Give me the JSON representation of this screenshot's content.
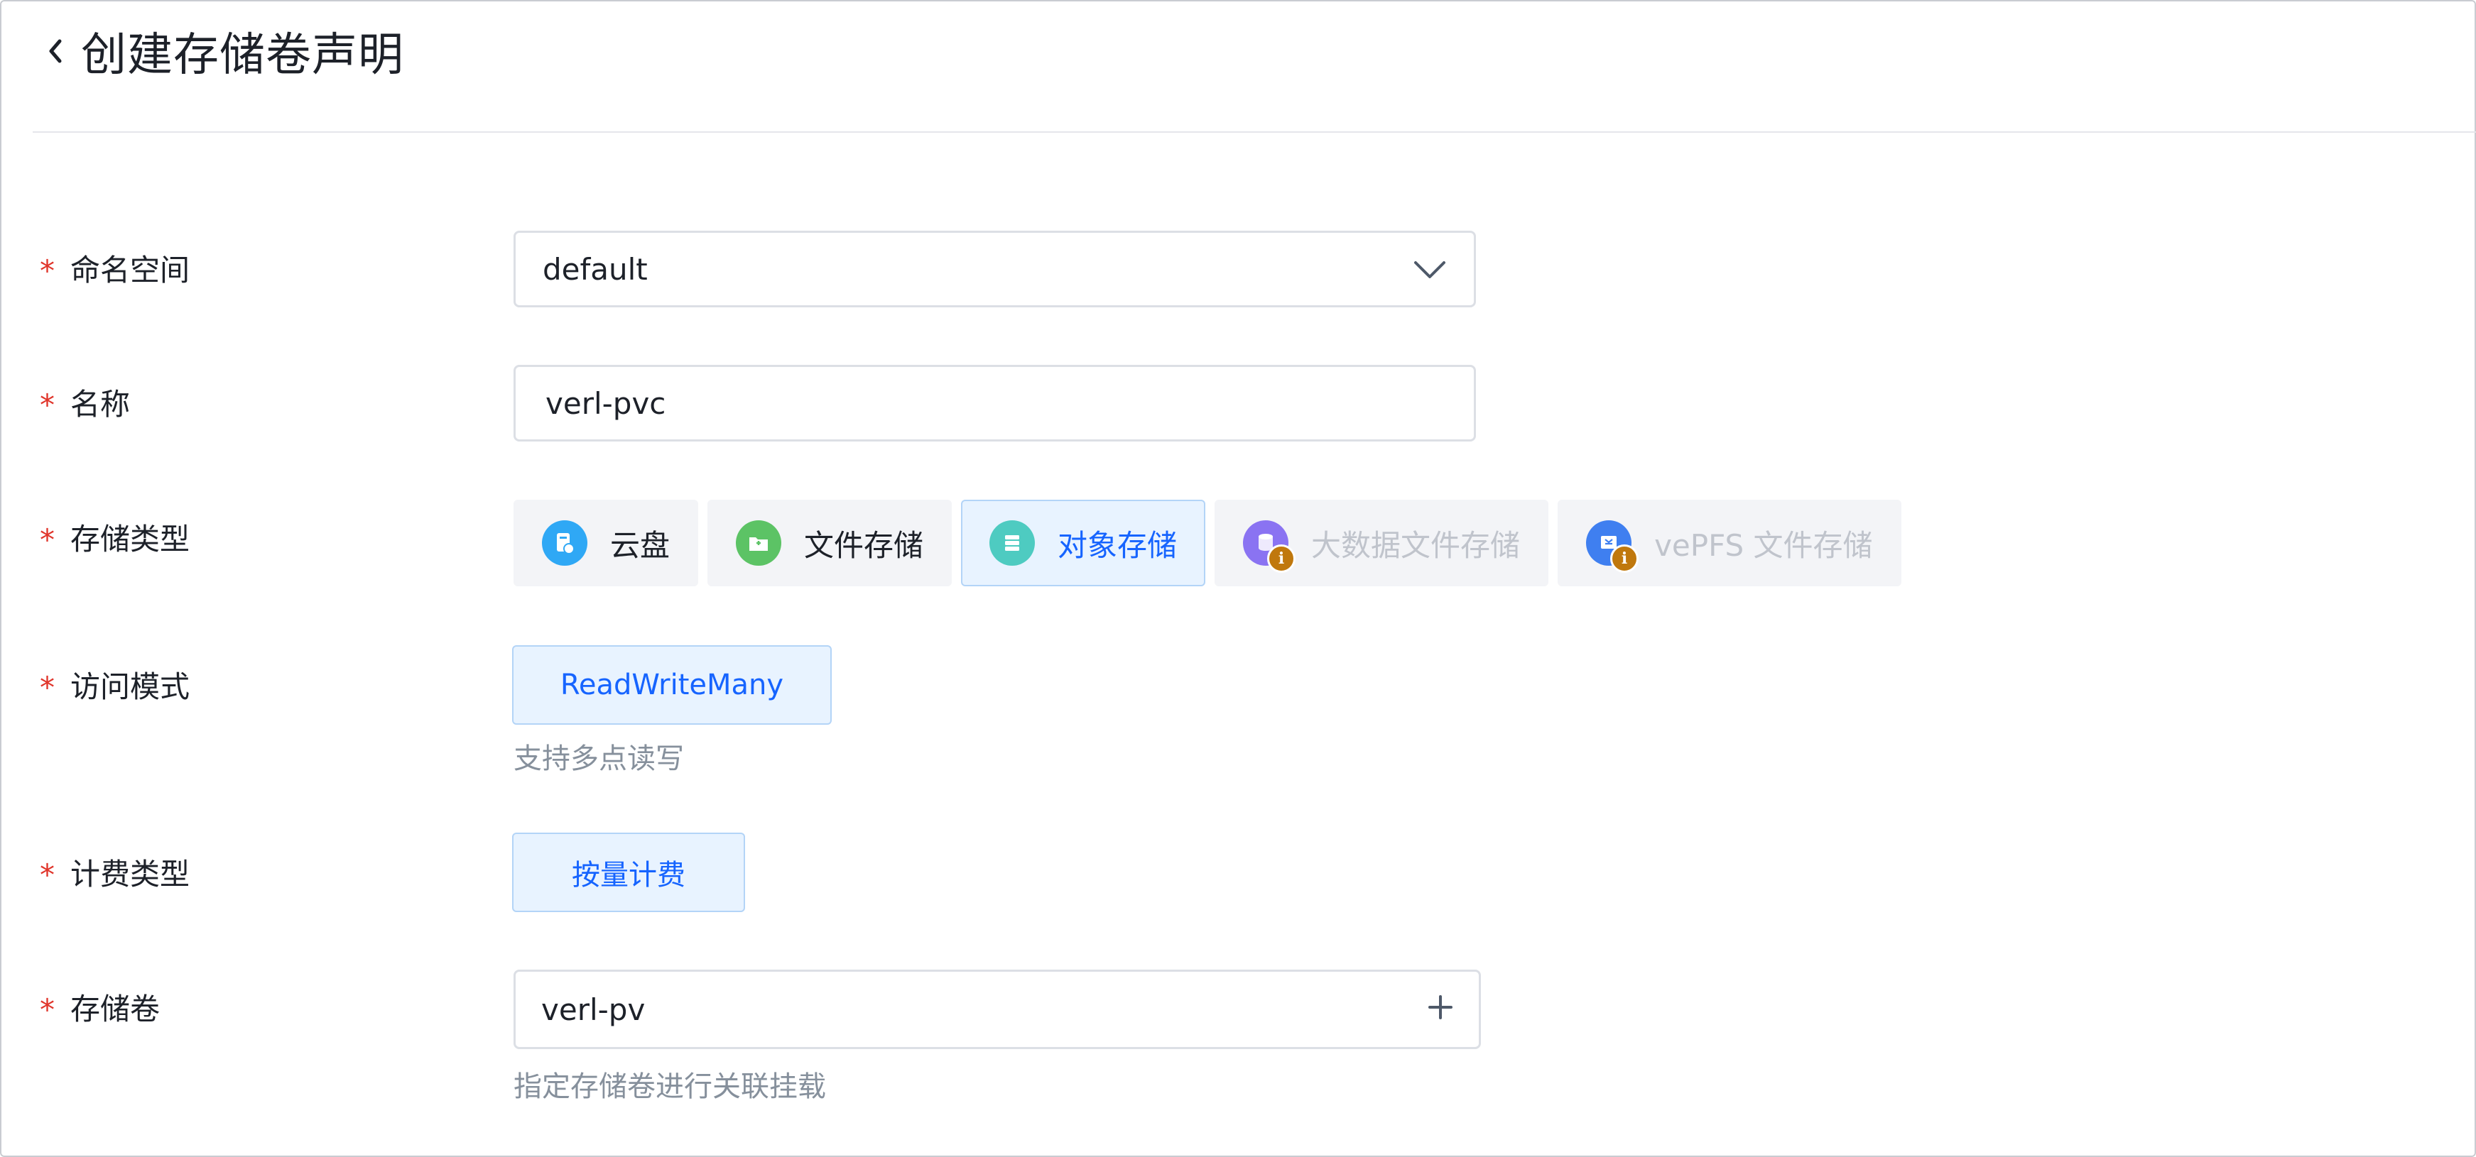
{
  "header": {
    "title": "创建存储卷声明"
  },
  "form": {
    "namespace": {
      "required_mark": "*",
      "label": "命名空间",
      "value": "default"
    },
    "name": {
      "required_mark": "*",
      "label": "名称",
      "value": "verl-pvc"
    },
    "storage_type": {
      "required_mark": "*",
      "label": "存储类型",
      "options": [
        {
          "label": "云盘",
          "icon": "cloud-disk-icon",
          "color": "#2fa8f5",
          "state": "normal"
        },
        {
          "label": "文件存储",
          "icon": "file-storage-icon",
          "color": "#5cc365",
          "state": "normal"
        },
        {
          "label": "对象存储",
          "icon": "object-storage-icon",
          "color": "#4ecbc1",
          "state": "selected"
        },
        {
          "label": "大数据文件存储",
          "icon": "bigdata-storage-icon",
          "color": "#8a73f2",
          "state": "disabled"
        },
        {
          "label": "vePFS 文件存储",
          "icon": "vepfs-storage-icon",
          "color": "#3f7ff0",
          "state": "disabled"
        }
      ]
    },
    "access_mode": {
      "required_mark": "*",
      "label": "访问模式",
      "option": "ReadWriteMany",
      "hint": "支持多点读写"
    },
    "billing_type": {
      "required_mark": "*",
      "label": "计费类型",
      "option": "按量计费"
    },
    "volume": {
      "required_mark": "*",
      "label": "存储卷",
      "value": "verl-pv",
      "hint": "指定存储卷进行关联挂载"
    }
  },
  "colors": {
    "accent": "#1664ff",
    "required": "#e0352b",
    "badge": "#c0780d"
  }
}
